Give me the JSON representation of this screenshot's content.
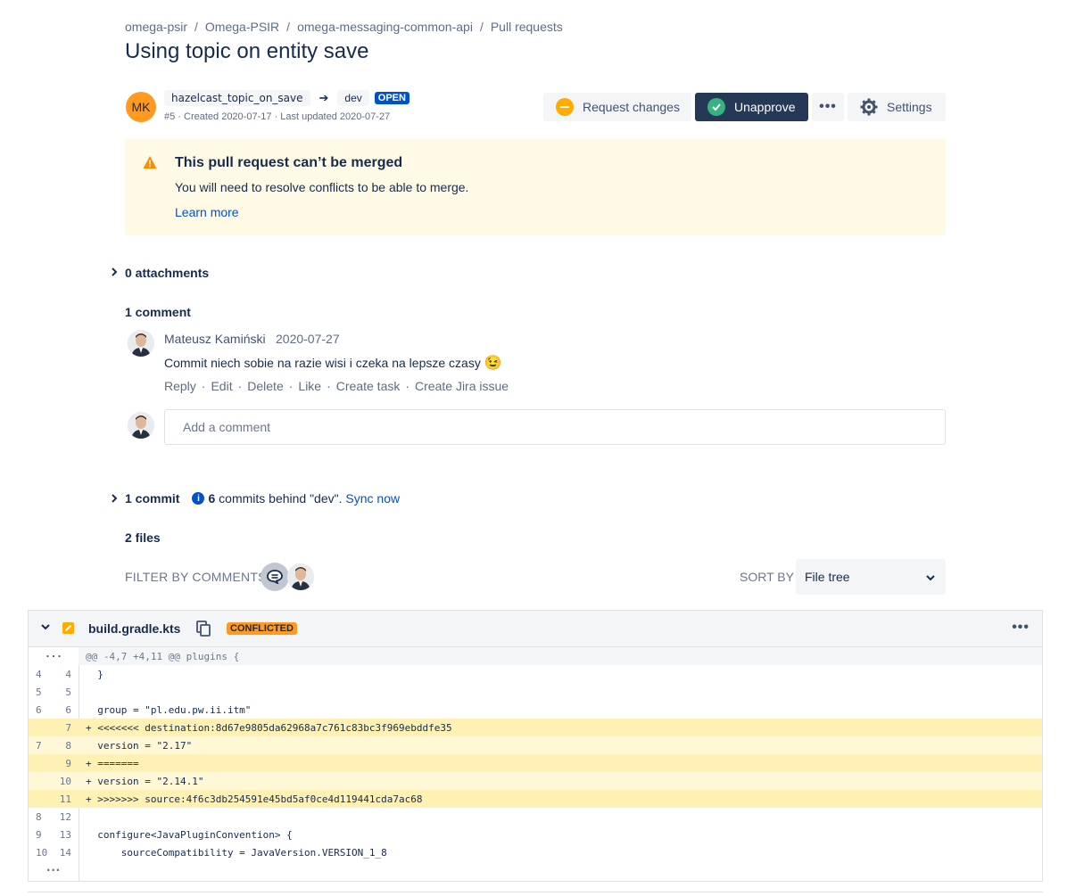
{
  "breadcrumbs": [
    "omega-psir",
    "Omega-PSIR",
    "omega-messaging-common-api",
    "Pull requests"
  ],
  "title": "Using topic on entity save",
  "author_initials": "MK",
  "source_branch": "hazelcast_topic_on_save",
  "target_branch": "dev",
  "status": "OPEN",
  "meta": "#5 · Created 2020-07-17 · Last updated 2020-07-27",
  "actions": {
    "request_changes": "Request changes",
    "unapprove": "Unapprove",
    "more": "•••",
    "settings": "Settings"
  },
  "warning": {
    "title": "This pull request can’t be merged",
    "text": "You will need to resolve conflicts to be able to merge.",
    "link": "Learn more"
  },
  "attachments": "0 attachments",
  "comments_heading": "1 comment",
  "comment": {
    "author": "Mateusz Kamiński",
    "date": "2020-07-27",
    "text": "Commit niech sobie na razie wisi i czeka na lepsze czasy",
    "emoji": "😉",
    "actions": [
      "Reply",
      "Edit",
      "Delete",
      "Like",
      "Create task",
      "Create Jira issue"
    ]
  },
  "comment_input": {
    "placeholder": "Add a comment"
  },
  "commits": {
    "heading": "1 commit",
    "behind_count": "6",
    "behind_text": " commits behind \"dev\". ",
    "sync": "Sync now"
  },
  "files_heading": "2 files",
  "filter_label": "FILTER BY COMMENTS",
  "sort_label": "SORT BY",
  "sort_value": "File tree",
  "file": {
    "name": "build.gradle.kts",
    "badge": "CONFLICTED",
    "more": "•••",
    "top_ellipsis": "···",
    "bottom_ellipsis": "···",
    "lines": [
      {
        "type": "hunk",
        "old": "",
        "new": "",
        "code": "@@ -4,7 +4,11 @@ plugins {"
      },
      {
        "type": "ctx",
        "old": "4",
        "new": "4",
        "code": "  }"
      },
      {
        "type": "ctx",
        "old": "5",
        "new": "5",
        "code": ""
      },
      {
        "type": "ctx",
        "old": "6",
        "new": "6",
        "code": "  group = \"pl.edu.pw.ii.itm\""
      },
      {
        "type": "conf",
        "old": "",
        "new": "7",
        "code": "+ <<<<<<< destination:8d67e9805da62968a7c761c83bc3f969ebddfe35"
      },
      {
        "type": "add",
        "old": "7",
        "new": "8",
        "code": "  version = \"2.17\""
      },
      {
        "type": "conf",
        "old": "",
        "new": "9",
        "code": "+ ======="
      },
      {
        "type": "add",
        "old": "",
        "new": "10",
        "code": "+ version = \"2.14.1\""
      },
      {
        "type": "conf",
        "old": "",
        "new": "11",
        "code": "+ >>>>>>> source:4f6c3db254591e45bd5af0ce4d119441cda7ac68"
      },
      {
        "type": "ctx",
        "old": "8",
        "new": "12",
        "code": ""
      },
      {
        "type": "ctx",
        "old": "9",
        "new": "13",
        "code": "  configure<JavaPluginConvention> {"
      },
      {
        "type": "ctx",
        "old": "10",
        "new": "14",
        "code": "      sourceCompatibility = JavaVersion.VERSION_1_8"
      }
    ]
  },
  "colors": {
    "primary_dark": "#253858",
    "link": "#0052cc",
    "warning_bg": "#fffae6",
    "conflict": "#ff991f",
    "approve_green": "#36b37e"
  }
}
